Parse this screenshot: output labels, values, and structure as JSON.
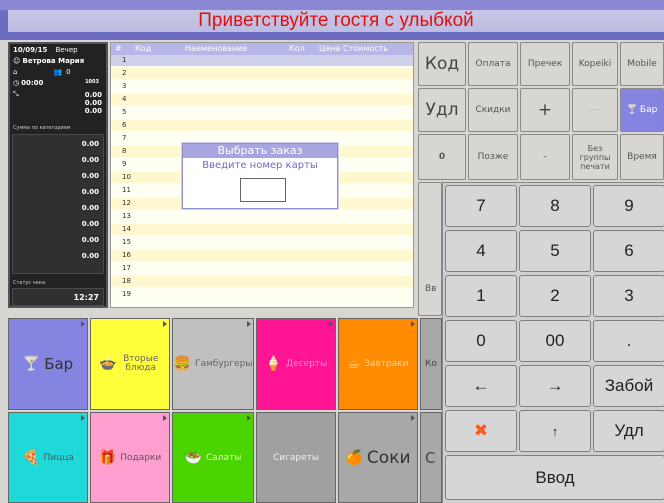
{
  "header": {
    "banner": "Приветствуйте гостя с улыбкой"
  },
  "left_panel": {
    "date": "10/09/15",
    "shift": "Вечер",
    "user": "Ветрова Мария",
    "guests": "0",
    "time": "00:00",
    "order_no": "1003",
    "totals": [
      "0.00",
      "0.00",
      "0.00"
    ],
    "category_sum_label": "Сумма по категориям",
    "category_values": [
      "0.00",
      "0.00",
      "0.00",
      "0.00",
      "0.00",
      "0.00",
      "0.00",
      "0.00"
    ],
    "check_status_label": "Статус чека:",
    "clock": "12:27"
  },
  "table": {
    "headers": [
      "#",
      "Код",
      "Наименование",
      "Кол",
      "Цена",
      "Стоимость"
    ],
    "rows": [
      "1",
      "2",
      "3",
      "4",
      "5",
      "6",
      "7",
      "8",
      "9",
      "10",
      "11",
      "12",
      "13",
      "14",
      "15",
      "16",
      "17",
      "18",
      "19"
    ]
  },
  "dialog": {
    "title": "Выбрать заказ",
    "prompt": "Введите номер карты"
  },
  "function_buttons": {
    "kod": "Код",
    "udl": "Удл",
    "zero": "0",
    "oplata": "Оплата",
    "prechek": "Пречек",
    "kopeiki": "Kopeiki",
    "mobile": "Mobile",
    "skidki": "Скидки",
    "plus": "+",
    "noprint": "Без группы печати",
    "vremya": "Время",
    "pozzhe": "Позже",
    "minus": "-",
    "bar_short": "Бар",
    "cut_in": "Вв"
  },
  "numpad": {
    "keys": [
      "7",
      "8",
      "9",
      "4",
      "5",
      "6",
      "1",
      "2",
      "3",
      "0",
      "00",
      ".",
      "←",
      "→",
      "Забой",
      "✖",
      "↑",
      "Удл"
    ],
    "enter": "Ввод"
  },
  "categories": [
    {
      "label": "Бар",
      "icon": "glass-icon",
      "color": "#8584e0"
    },
    {
      "label": "Вторые блюда",
      "icon": "dish-icon",
      "color": "#ffff3c"
    },
    {
      "label": "Гамбургеры",
      "icon": "burger-icon",
      "color": "#c0c0c0"
    },
    {
      "label": "Десерты",
      "icon": "icecream-icon",
      "color": "#ff1493"
    },
    {
      "label": "Завтраки",
      "icon": "breakfast-icon",
      "color": "#ff8c00"
    },
    {
      "label": "Пицца",
      "icon": "pizza-icon",
      "color": "#1fd8d8"
    },
    {
      "label": "Подарки",
      "icon": "gift-icon",
      "color": "#ff9fd0"
    },
    {
      "label": "Салаты",
      "icon": "salad-icon",
      "color": "#4cd400"
    },
    {
      "label": "Сигареты",
      "icon": "",
      "color": "#a0a0a0"
    },
    {
      "label": "Соки",
      "icon": "juice-icon",
      "color": "#a8a8a8"
    }
  ],
  "partial_labels": {
    "ko": "Ко",
    "c": "С"
  }
}
